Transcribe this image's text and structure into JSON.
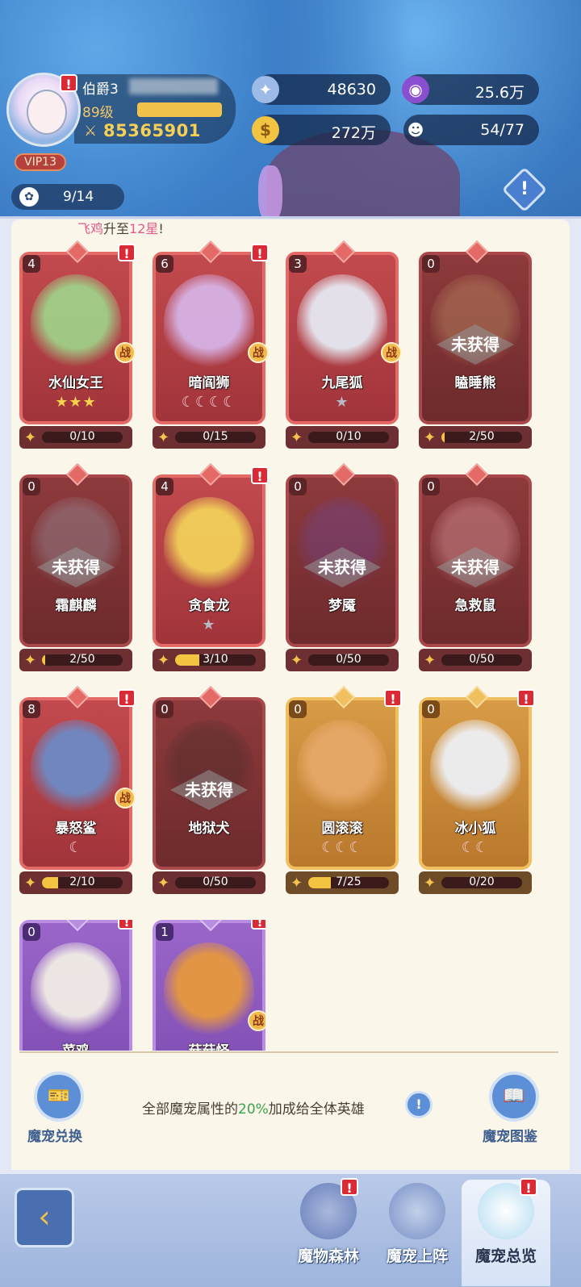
{
  "player": {
    "name": "伯爵3",
    "level": "89级",
    "power": "85365901",
    "vip": "VIP13",
    "slots": "9/14"
  },
  "resources": {
    "gems": "48630",
    "orbs": "25.6万",
    "gold": "272万",
    "population": "54/77"
  },
  "ticker": {
    "prefix": "飞鸡",
    "text": "升至",
    "highlight": "12星",
    "suffix": "!"
  },
  "pets": [
    {
      "count": "4",
      "name": "水仙女王",
      "stars": "★★★",
      "star_type": "gold",
      "fragments": "0/10",
      "progress": 0,
      "color": "red",
      "locked": false,
      "battle": true,
      "alert": true
    },
    {
      "count": "6",
      "name": "暗阎狮",
      "stars": "☾☾☾☾",
      "star_type": "moon",
      "fragments": "0/15",
      "progress": 0,
      "color": "red",
      "locked": false,
      "battle": true,
      "alert": true
    },
    {
      "count": "3",
      "name": "九尾狐",
      "stars": "★",
      "star_type": "silver",
      "fragments": "0/10",
      "progress": 0,
      "color": "red",
      "locked": false,
      "battle": true,
      "alert": false
    },
    {
      "count": "0",
      "name": "瞌睡熊",
      "stars": "",
      "star_type": "silver",
      "fragments": "2/50",
      "progress": 0.04,
      "color": "red",
      "locked": true,
      "battle": false,
      "alert": false
    },
    {
      "count": "0",
      "name": "霜麒麟",
      "stars": "",
      "star_type": "silver",
      "fragments": "2/50",
      "progress": 0.04,
      "color": "red",
      "locked": true,
      "battle": false,
      "alert": false
    },
    {
      "count": "4",
      "name": "贪食龙",
      "stars": "★",
      "star_type": "silver",
      "fragments": "3/10",
      "progress": 0.3,
      "color": "red",
      "locked": false,
      "battle": false,
      "alert": true
    },
    {
      "count": "0",
      "name": "梦魇",
      "stars": "",
      "star_type": "silver",
      "fragments": "0/50",
      "progress": 0,
      "color": "red",
      "locked": true,
      "battle": false,
      "alert": false
    },
    {
      "count": "0",
      "name": "急救鼠",
      "stars": "",
      "star_type": "silver",
      "fragments": "0/50",
      "progress": 0,
      "color": "red",
      "locked": true,
      "battle": false,
      "alert": false
    },
    {
      "count": "8",
      "name": "暴怒鲨",
      "stars": "☾",
      "star_type": "moon",
      "fragments": "2/10",
      "progress": 0.2,
      "color": "red",
      "locked": false,
      "battle": true,
      "alert": true
    },
    {
      "count": "0",
      "name": "地狱犬",
      "stars": "",
      "star_type": "silver",
      "fragments": "0/50",
      "progress": 0,
      "color": "red",
      "locked": true,
      "battle": false,
      "alert": false
    },
    {
      "count": "0",
      "name": "圆滚滚",
      "stars": "☾☾☾",
      "star_type": "moon",
      "fragments": "7/25",
      "progress": 0.28,
      "color": "gold",
      "locked": false,
      "battle": false,
      "alert": true
    },
    {
      "count": "0",
      "name": "冰小狐",
      "stars": "☾☾",
      "star_type": "moon",
      "fragments": "0/20",
      "progress": 0,
      "color": "gold",
      "locked": false,
      "battle": false,
      "alert": true
    },
    {
      "count": "0",
      "name": "菜鸡",
      "stars": "",
      "star_type": "silver",
      "fragments": "",
      "progress": 0,
      "color": "purple",
      "locked": false,
      "battle": false,
      "alert": true
    },
    {
      "count": "1",
      "name": "菇菇怪",
      "stars": "",
      "star_type": "silver",
      "fragments": "",
      "progress": 0,
      "color": "purple",
      "locked": false,
      "battle": true,
      "alert": true
    }
  ],
  "locked_label": "未获得",
  "battle_label": "战",
  "exchange_label": "魔宠兑换",
  "codex_label": "魔宠图鉴",
  "bonus": {
    "prefix": "全部魔宠属性的",
    "percent": "20%",
    "suffix": "加成给全体英雄"
  },
  "nav": {
    "forest": "魔物森林",
    "deploy": "魔宠上阵",
    "overview": "魔宠总览"
  },
  "icons": {
    "alert": "!",
    "power": "⚔",
    "fragment": "✦"
  }
}
